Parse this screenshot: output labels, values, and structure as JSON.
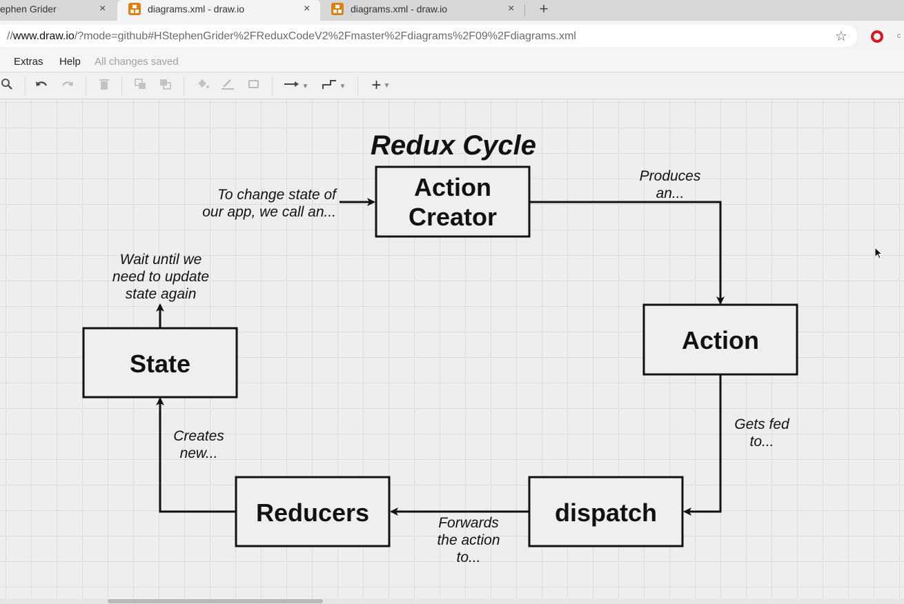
{
  "browser": {
    "tabs": [
      {
        "title": "ephen Grider",
        "close": "×"
      },
      {
        "title": "diagrams.xml - draw.io",
        "close": "×",
        "active": true
      },
      {
        "title": "diagrams.xml - draw.io",
        "close": "×"
      }
    ],
    "new_tab": "+",
    "url_prefix": "//",
    "url_host": "www.draw.io",
    "url_rest": "/?mode=github#HStephenGrider%2FReduxCodeV2%2Fmaster%2Fdiagrams%2F09%2Fdiagrams.xml",
    "bookmark_icon": "star-icon",
    "extension_icon": "opera-icon",
    "extension_text": "c"
  },
  "menubar": {
    "items": [
      "Extras",
      "Help"
    ],
    "status": "All changes saved"
  },
  "toolbar": {
    "icons": [
      "zoom-icon",
      "undo-icon",
      "redo-icon",
      "delete-icon",
      "to-front-icon",
      "to-back-icon",
      "fill-color-icon",
      "line-color-icon",
      "shadow-icon",
      "connection-icon",
      "waypoints-icon",
      "insert-icon"
    ]
  },
  "diagram": {
    "title": "Redux Cycle",
    "nodes": {
      "action_creator": [
        "Action",
        "Creator"
      ],
      "action": "Action",
      "dispatch": "dispatch",
      "reducers": "Reducers",
      "state": "State"
    },
    "labels": {
      "to_change": [
        "To change state of",
        "our app, we call an..."
      ],
      "produces": [
        "Produces",
        "an..."
      ],
      "gets_fed": [
        "Gets fed",
        "to..."
      ],
      "forwards": [
        "Forwards",
        "the action",
        "to..."
      ],
      "creates": [
        "Creates",
        "new..."
      ],
      "wait": [
        "Wait until we",
        "need to update",
        "state again"
      ]
    }
  }
}
